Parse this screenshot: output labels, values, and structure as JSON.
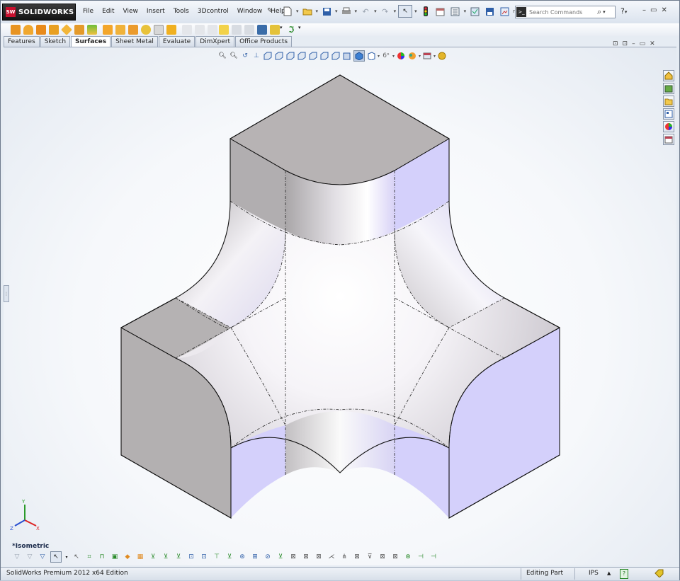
{
  "app": {
    "name": "SOLIDWORKS",
    "logo_badge": "SW",
    "edition": "SolidWorks Premium 2012 x64 Edition"
  },
  "menu": [
    "File",
    "Edit",
    "View",
    "Insert",
    "Tools",
    "3Dcontrol",
    "Window",
    "Help"
  ],
  "search": {
    "placeholder": "Search Commands",
    "badge": ">_"
  },
  "tabs": [
    {
      "label": "Features",
      "active": false
    },
    {
      "label": "Sketch",
      "active": false
    },
    {
      "label": "Surfaces",
      "active": true
    },
    {
      "label": "Sheet Metal",
      "active": false
    },
    {
      "label": "Evaluate",
      "active": false
    },
    {
      "label": "DimXpert",
      "active": false
    },
    {
      "label": "Office Products",
      "active": false
    }
  ],
  "viewport": {
    "view_name": "*Isometric",
    "triad_axes": [
      "Y",
      "Z",
      "X"
    ]
  },
  "status": {
    "editing": "Editing Part",
    "units": "IPS",
    "units_arrow": "▲",
    "help": "?"
  },
  "colors": {
    "accent": "#c8102e",
    "model_gray": "#b3b0b1",
    "model_lilac": "#d4d0fb",
    "background_blue": "#e3e9f1"
  }
}
